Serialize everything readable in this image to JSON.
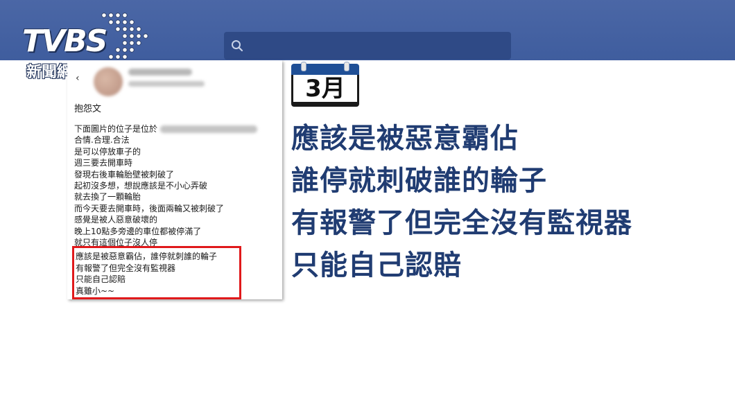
{
  "header": {
    "logo_main": "TVBS",
    "logo_sub": "新聞網",
    "search_icon": "search-icon"
  },
  "post": {
    "heading": "抱怨文",
    "lines": [
      "下面圖片的位子是位於",
      "合情.合理.合法",
      "是可以停放車子的",
      "週三要去開車時",
      "發現右後車輪胎壁被刺破了",
      "起初沒多想，想說應該是不小心弄破",
      "就去換了一顆輪胎",
      "而今天要去開車時，後面兩輪又被刺破了",
      "感覺是被人惡意破壞的",
      "晚上10點多旁邊的車位都被停滿了",
      "就只有這個位子沒人停"
    ],
    "highlighted_lines": [
      "應該是被惡意霸佔，誰停就刺誰的輪子",
      "有報警了但完全沒有監視器",
      "只能自己認賠",
      "真雖小~~"
    ]
  },
  "calendar": {
    "label": "3月"
  },
  "headline": {
    "lines": [
      "應該是被惡意霸佔",
      "誰停就刺破誰的輪子",
      "有報警了但完全沒有監視器",
      "只能自己認賠"
    ]
  },
  "colors": {
    "topbar": "#4b67a6",
    "headline": "#203c72",
    "highlight_border": "#e0191b",
    "calendar_top": "#1f4f96"
  }
}
